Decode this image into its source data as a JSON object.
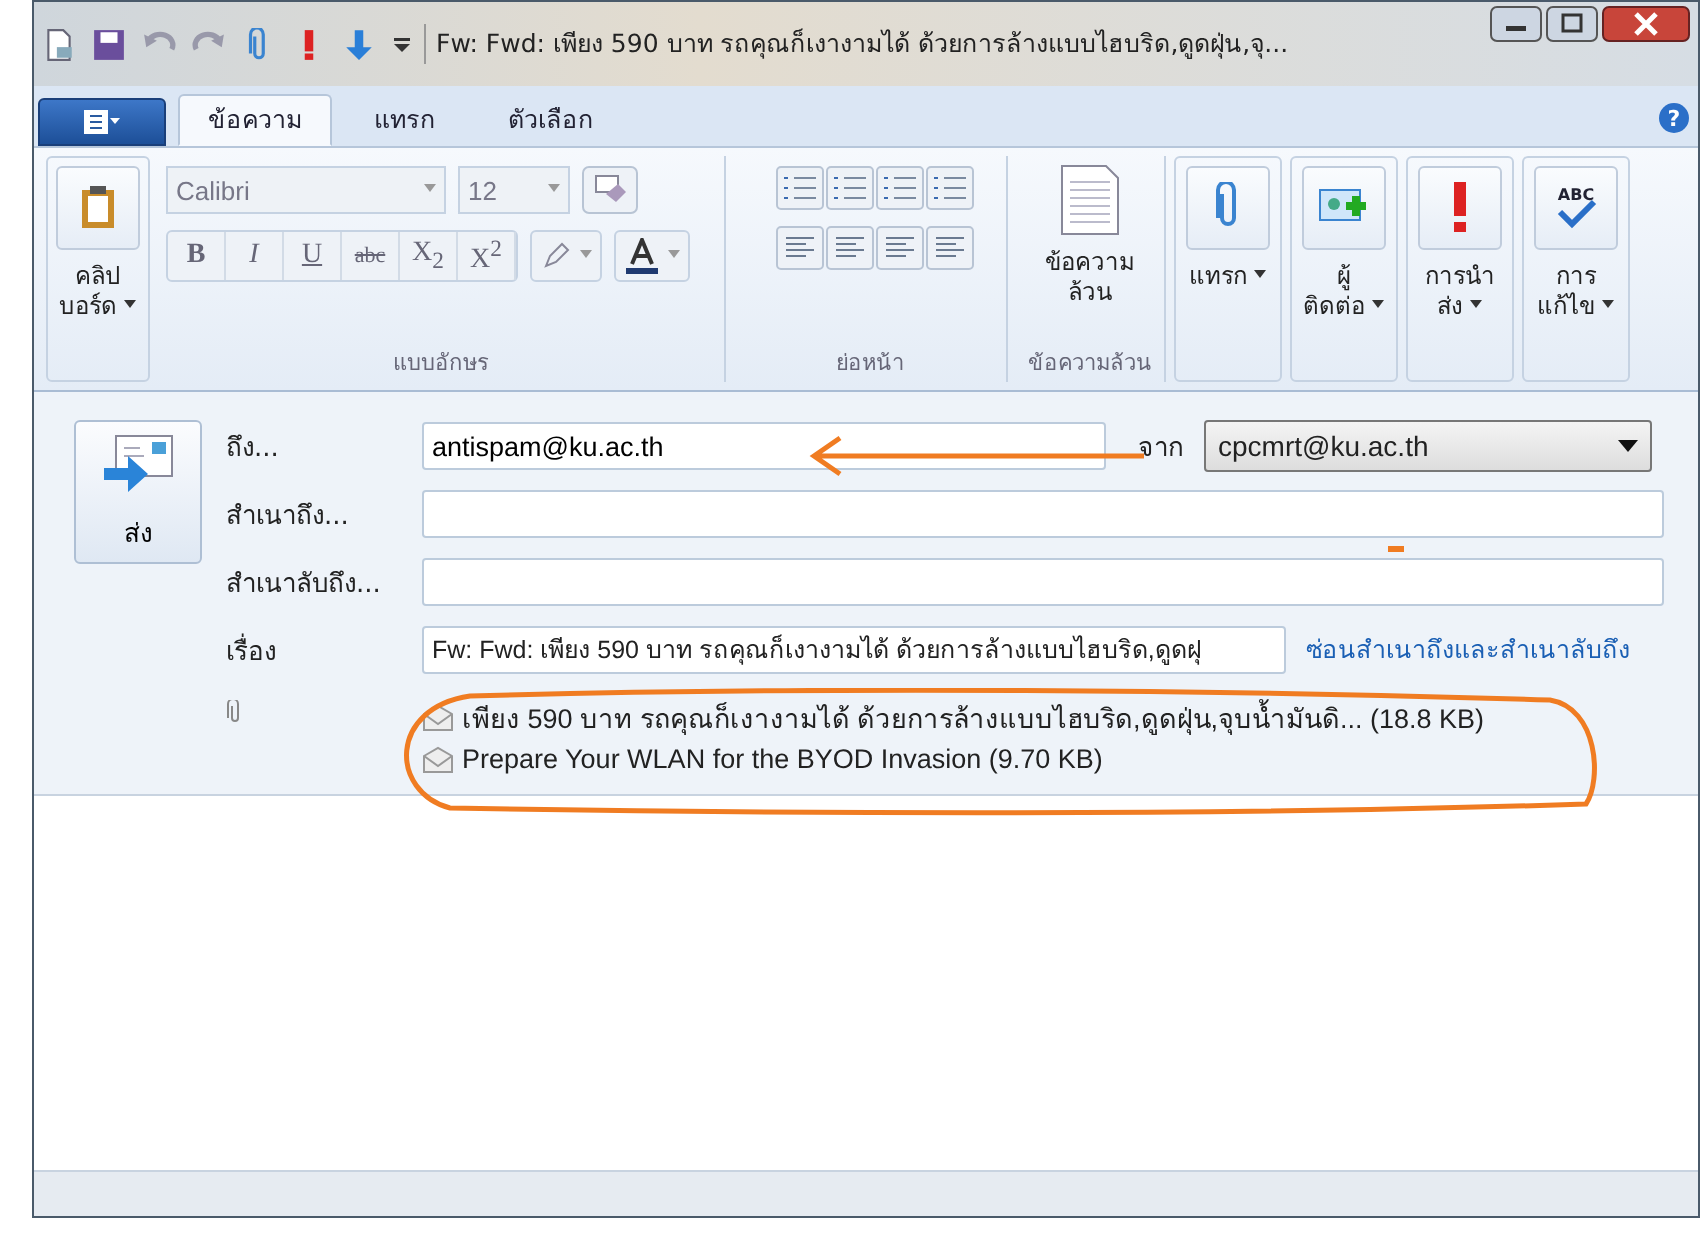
{
  "window": {
    "title": "Fw: Fwd: เพียง 590 บาท รถคุณก็เงางามได้ ด้วยการล้างแบบไฮบริด,ดูดฝุ่น,จุ..."
  },
  "tabs": [
    {
      "label": "ข้อความ",
      "selected": true
    },
    {
      "label": "แทรก",
      "selected": false
    },
    {
      "label": "ตัวเลือก",
      "selected": false
    }
  ],
  "ribbon": {
    "clipboard": {
      "label": "คลิป\nบอร์ด"
    },
    "font": {
      "name": "Calibri",
      "size": "12",
      "format_buttons": [
        "B",
        "I",
        "U",
        "abc",
        "X$_{2}$",
        "X$^{2}$"
      ],
      "group_label": "แบบอักษร"
    },
    "paragraph": {
      "group_label": "ย่อหน้า"
    },
    "plain_text": {
      "label": "ข้อความ\nล้วน",
      "group_label": "ข้อความล้วน"
    },
    "big_buttons": [
      {
        "kind": "insert",
        "label": "แทรก"
      },
      {
        "kind": "contacts",
        "label": "ผู้\nติดต่อ"
      },
      {
        "kind": "priority",
        "label": "การนำ\nส่ง"
      },
      {
        "kind": "spelling",
        "label": "การ\nแก้ไข",
        "icon_text": "ABC"
      }
    ]
  },
  "help": "?",
  "compose": {
    "send": "ส่ง",
    "to": {
      "label": "ถึง...",
      "value": "antispam@ku.ac.th"
    },
    "from": {
      "label": "จาก",
      "value": "cpcmrt@ku.ac.th"
    },
    "cc": {
      "label": "สำเนาถึง..."
    },
    "bcc": {
      "label": "สำเนาลับถึง..."
    },
    "subject": {
      "label": "เรื่อง",
      "value": "Fw: Fwd: เพียง 590 บาท รถคุณก็เงางามได้ ด้วยการล้างแบบไฮบริด,ดูดฝุ"
    },
    "hide_link": "ซ่อนสำเนาถึงและสำเนาลับถึง",
    "attachments": [
      {
        "name": "เพียง 590 บาท รถคุณก็เงางามได้ ด้วยการล้างแบบไฮบริด,ดูดฝุ่น,จุบน้ำมันดิ...",
        "size": "(18.8 KB)"
      },
      {
        "name": "Prepare Your WLAN for the BYOD Invasion",
        "size": "(9.70 KB)"
      }
    ]
  }
}
